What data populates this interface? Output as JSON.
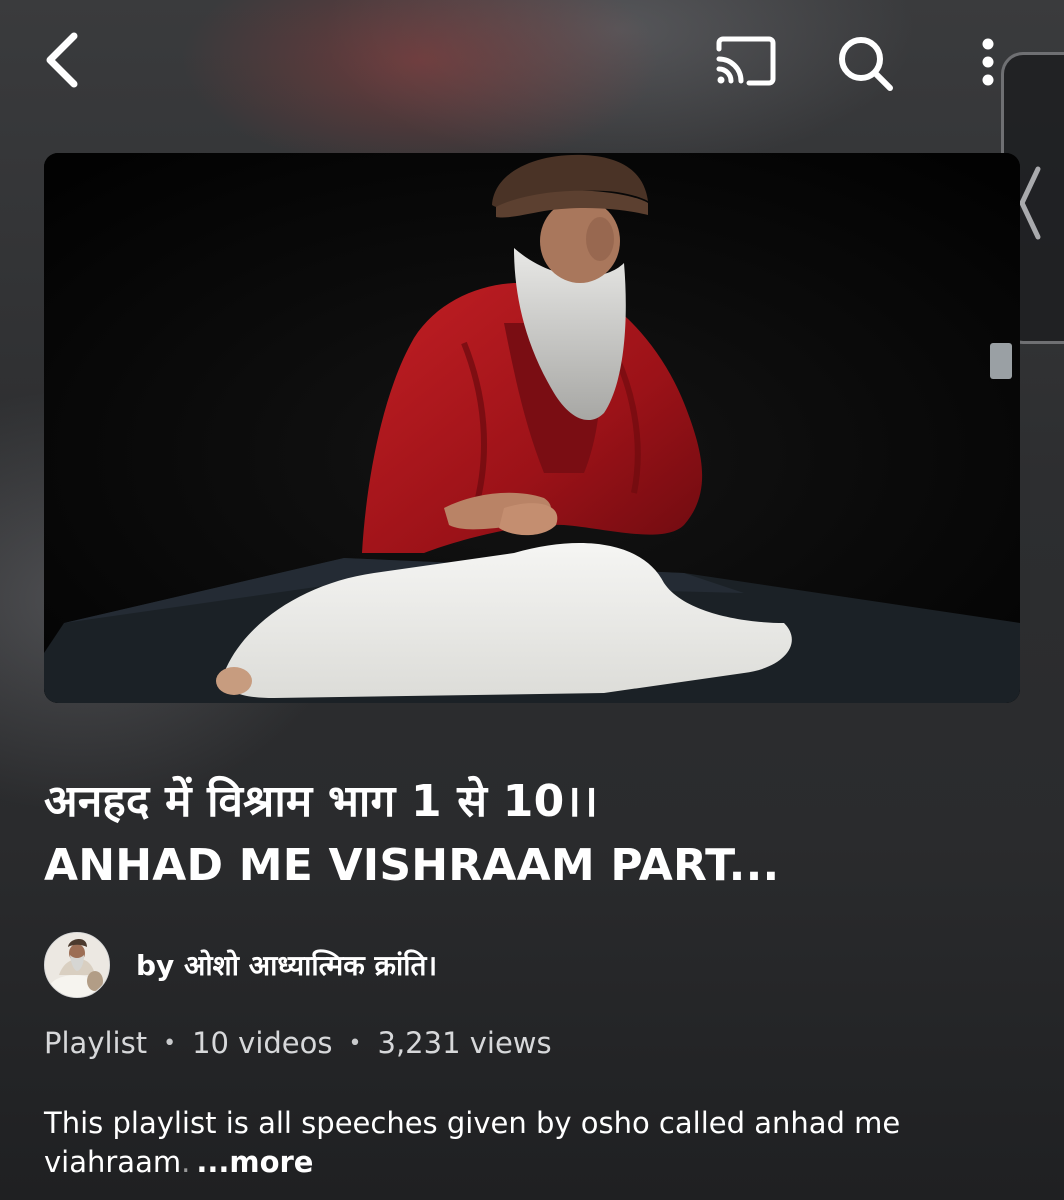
{
  "topbar": {
    "back_icon": "chevron-left-icon",
    "cast_icon": "cast-icon",
    "search_icon": "search-icon",
    "more_icon": "more-vertical-icon"
  },
  "side_handle": {
    "icon": "chevron-left-icon"
  },
  "playlist": {
    "thumbnail_icon": "playlist-thumbnail",
    "title_line1": "अनहद में विश्राम भाग 1 से 10।।",
    "title_line2": "ANHAD ME VISHRAAM PART...",
    "channel": "by ओशो आध्यात्मिक क्रांति।",
    "meta": {
      "type": "Playlist",
      "videos": "10 videos",
      "views": "3,231 views",
      "separator": "•"
    },
    "description": {
      "line1": "This playlist is all speeches given by osho called anhad me",
      "line2": "viahraam",
      "line2_fade": ".",
      "more_label": "...more"
    }
  },
  "colors": {
    "background": "#2b2c2e",
    "text_primary": "#ffffff",
    "text_secondary": "#d7d8da",
    "robe_red": "#a8141c"
  }
}
